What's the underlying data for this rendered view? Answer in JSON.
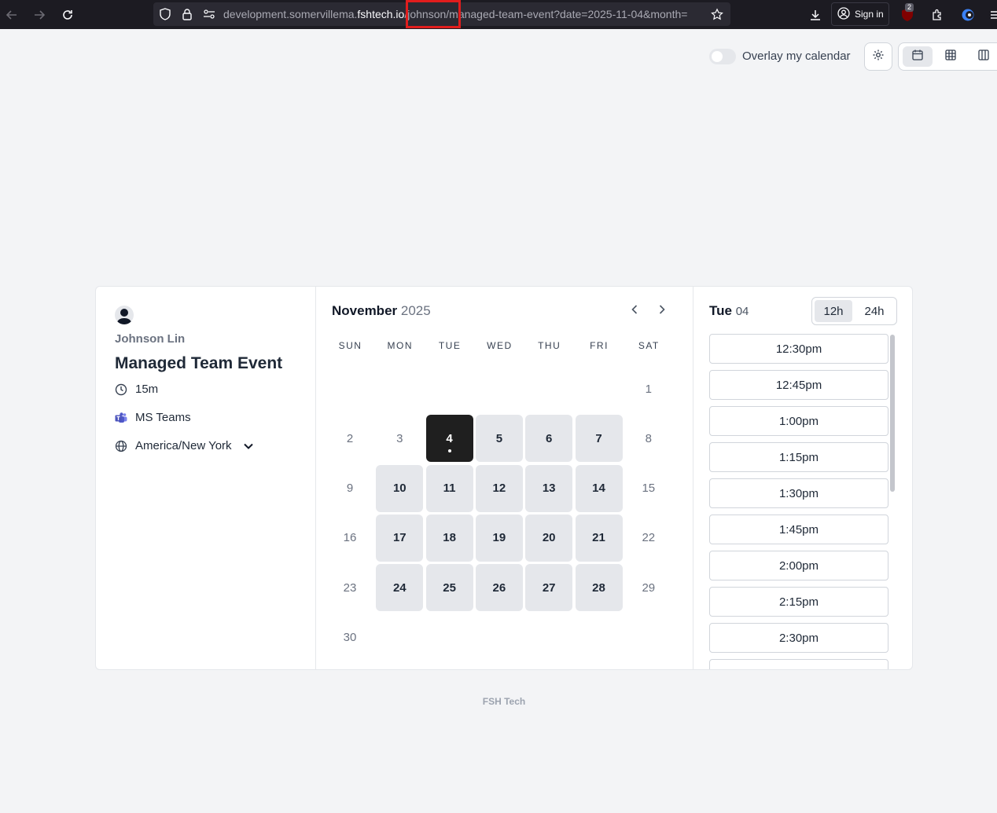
{
  "browser": {
    "url_prefix": "development.somervillema.",
    "url_host": "fshtech.io",
    "url_path": "/johnson/managed-team-event?date=2025-11-04&month=",
    "signin_label": "Sign in",
    "extension_badge": "2",
    "highlight_color": "#e11d1d"
  },
  "toolbar": {
    "overlay_label": "Overlay my calendar",
    "overlay_on": false,
    "active_view": "month"
  },
  "event": {
    "host_name": "Johnson Lin",
    "title": "Managed Team Event",
    "duration": "15m",
    "location": "MS Teams",
    "timezone": "America/New York"
  },
  "calendar": {
    "month": "November",
    "year": "2025",
    "weekdays": [
      "SUN",
      "MON",
      "TUE",
      "WED",
      "THU",
      "FRI",
      "SAT"
    ],
    "first_weekday_index": 6,
    "days_in_month": 30,
    "available_days": [
      5,
      6,
      7,
      10,
      11,
      12,
      13,
      14,
      17,
      18,
      19,
      20,
      21,
      24,
      25,
      26,
      27,
      28
    ],
    "selected_day": 4
  },
  "slots": {
    "day_name": "Tue",
    "day_num": "04",
    "format_12h": "12h",
    "format_24h": "24h",
    "active_format": "12h",
    "times": [
      "12:30pm",
      "12:45pm",
      "1:00pm",
      "1:15pm",
      "1:30pm",
      "1:45pm",
      "2:00pm",
      "2:15pm",
      "2:30pm",
      ""
    ]
  },
  "footer": {
    "brand": "FSH Tech"
  }
}
